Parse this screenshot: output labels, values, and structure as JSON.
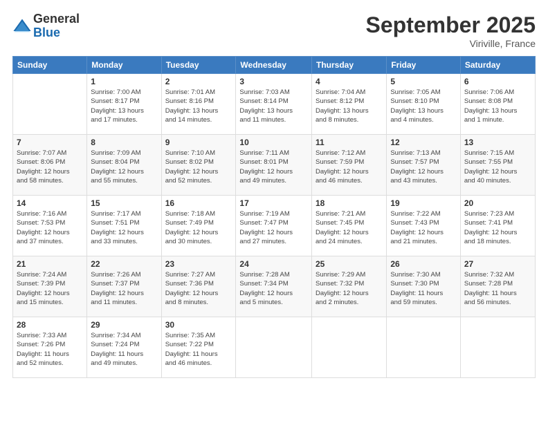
{
  "logo": {
    "general": "General",
    "blue": "Blue"
  },
  "header": {
    "month": "September 2025",
    "location": "Viriville, France"
  },
  "weekdays": [
    "Sunday",
    "Monday",
    "Tuesday",
    "Wednesday",
    "Thursday",
    "Friday",
    "Saturday"
  ],
  "weeks": [
    [
      {
        "day": "",
        "info": ""
      },
      {
        "day": "1",
        "info": "Sunrise: 7:00 AM\nSunset: 8:17 PM\nDaylight: 13 hours\nand 17 minutes."
      },
      {
        "day": "2",
        "info": "Sunrise: 7:01 AM\nSunset: 8:16 PM\nDaylight: 13 hours\nand 14 minutes."
      },
      {
        "day": "3",
        "info": "Sunrise: 7:03 AM\nSunset: 8:14 PM\nDaylight: 13 hours\nand 11 minutes."
      },
      {
        "day": "4",
        "info": "Sunrise: 7:04 AM\nSunset: 8:12 PM\nDaylight: 13 hours\nand 8 minutes."
      },
      {
        "day": "5",
        "info": "Sunrise: 7:05 AM\nSunset: 8:10 PM\nDaylight: 13 hours\nand 4 minutes."
      },
      {
        "day": "6",
        "info": "Sunrise: 7:06 AM\nSunset: 8:08 PM\nDaylight: 13 hours\nand 1 minute."
      }
    ],
    [
      {
        "day": "7",
        "info": "Sunrise: 7:07 AM\nSunset: 8:06 PM\nDaylight: 12 hours\nand 58 minutes."
      },
      {
        "day": "8",
        "info": "Sunrise: 7:09 AM\nSunset: 8:04 PM\nDaylight: 12 hours\nand 55 minutes."
      },
      {
        "day": "9",
        "info": "Sunrise: 7:10 AM\nSunset: 8:02 PM\nDaylight: 12 hours\nand 52 minutes."
      },
      {
        "day": "10",
        "info": "Sunrise: 7:11 AM\nSunset: 8:01 PM\nDaylight: 12 hours\nand 49 minutes."
      },
      {
        "day": "11",
        "info": "Sunrise: 7:12 AM\nSunset: 7:59 PM\nDaylight: 12 hours\nand 46 minutes."
      },
      {
        "day": "12",
        "info": "Sunrise: 7:13 AM\nSunset: 7:57 PM\nDaylight: 12 hours\nand 43 minutes."
      },
      {
        "day": "13",
        "info": "Sunrise: 7:15 AM\nSunset: 7:55 PM\nDaylight: 12 hours\nand 40 minutes."
      }
    ],
    [
      {
        "day": "14",
        "info": "Sunrise: 7:16 AM\nSunset: 7:53 PM\nDaylight: 12 hours\nand 37 minutes."
      },
      {
        "day": "15",
        "info": "Sunrise: 7:17 AM\nSunset: 7:51 PM\nDaylight: 12 hours\nand 33 minutes."
      },
      {
        "day": "16",
        "info": "Sunrise: 7:18 AM\nSunset: 7:49 PM\nDaylight: 12 hours\nand 30 minutes."
      },
      {
        "day": "17",
        "info": "Sunrise: 7:19 AM\nSunset: 7:47 PM\nDaylight: 12 hours\nand 27 minutes."
      },
      {
        "day": "18",
        "info": "Sunrise: 7:21 AM\nSunset: 7:45 PM\nDaylight: 12 hours\nand 24 minutes."
      },
      {
        "day": "19",
        "info": "Sunrise: 7:22 AM\nSunset: 7:43 PM\nDaylight: 12 hours\nand 21 minutes."
      },
      {
        "day": "20",
        "info": "Sunrise: 7:23 AM\nSunset: 7:41 PM\nDaylight: 12 hours\nand 18 minutes."
      }
    ],
    [
      {
        "day": "21",
        "info": "Sunrise: 7:24 AM\nSunset: 7:39 PM\nDaylight: 12 hours\nand 15 minutes."
      },
      {
        "day": "22",
        "info": "Sunrise: 7:26 AM\nSunset: 7:37 PM\nDaylight: 12 hours\nand 11 minutes."
      },
      {
        "day": "23",
        "info": "Sunrise: 7:27 AM\nSunset: 7:36 PM\nDaylight: 12 hours\nand 8 minutes."
      },
      {
        "day": "24",
        "info": "Sunrise: 7:28 AM\nSunset: 7:34 PM\nDaylight: 12 hours\nand 5 minutes."
      },
      {
        "day": "25",
        "info": "Sunrise: 7:29 AM\nSunset: 7:32 PM\nDaylight: 12 hours\nand 2 minutes."
      },
      {
        "day": "26",
        "info": "Sunrise: 7:30 AM\nSunset: 7:30 PM\nDaylight: 11 hours\nand 59 minutes."
      },
      {
        "day": "27",
        "info": "Sunrise: 7:32 AM\nSunset: 7:28 PM\nDaylight: 11 hours\nand 56 minutes."
      }
    ],
    [
      {
        "day": "28",
        "info": "Sunrise: 7:33 AM\nSunset: 7:26 PM\nDaylight: 11 hours\nand 52 minutes."
      },
      {
        "day": "29",
        "info": "Sunrise: 7:34 AM\nSunset: 7:24 PM\nDaylight: 11 hours\nand 49 minutes."
      },
      {
        "day": "30",
        "info": "Sunrise: 7:35 AM\nSunset: 7:22 PM\nDaylight: 11 hours\nand 46 minutes."
      },
      {
        "day": "",
        "info": ""
      },
      {
        "day": "",
        "info": ""
      },
      {
        "day": "",
        "info": ""
      },
      {
        "day": "",
        "info": ""
      }
    ]
  ]
}
